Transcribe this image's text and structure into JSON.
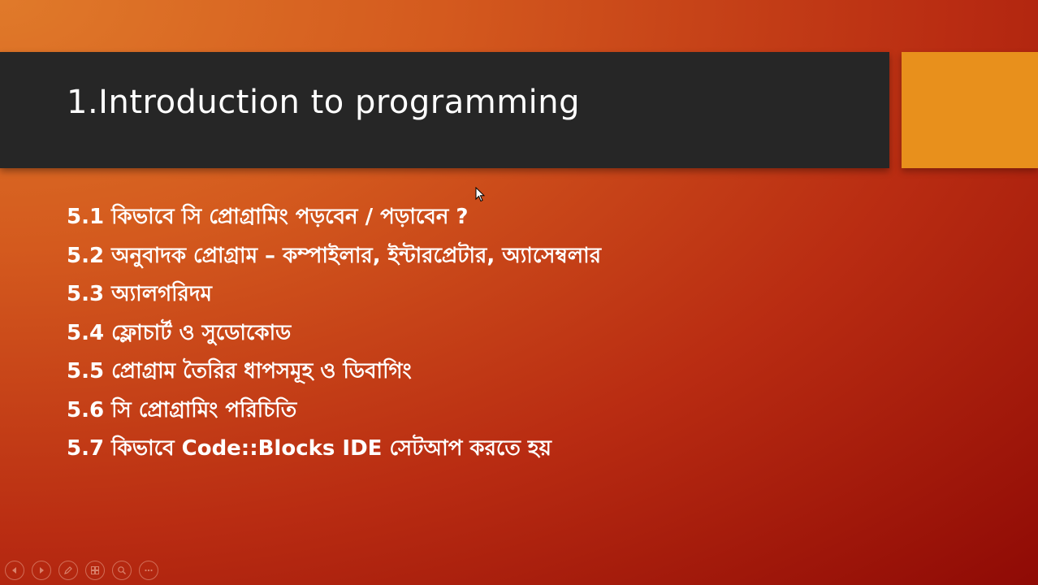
{
  "slide": {
    "title": "1.Introduction to programming",
    "bullets": [
      "5.1 কিভাবে সি প্রোগ্রামিং পড়বেন / পড়াবেন ?",
      "5.2 অনুবাদক প্রোগ্রাম – কম্পাইলার, ইন্টারপ্রেটার, অ্যাসেম্বলার",
      "5.3 অ্যালগরিদম",
      "5.4 ফ্লোচার্ট ও সুডোকোড",
      "5.5 প্রোগ্রাম তৈরির ধাপসমূহ ও ডিবাগিং",
      "5.6 সি প্রোগ্রামিং পরিচিতি",
      "5.7 কিভাবে Code::Blocks IDE সেটআপ করতে হয়"
    ]
  },
  "colors": {
    "title_bar": "#262626",
    "accent_block": "#e8901c",
    "text": "#ffffff",
    "background_start": "#e07a2a",
    "background_end": "#8f0a05"
  },
  "controls": {
    "icons": [
      "previous-slide-icon",
      "next-slide-icon",
      "pen-icon",
      "slide-sorter-icon",
      "zoom-icon",
      "more-options-icon"
    ]
  }
}
